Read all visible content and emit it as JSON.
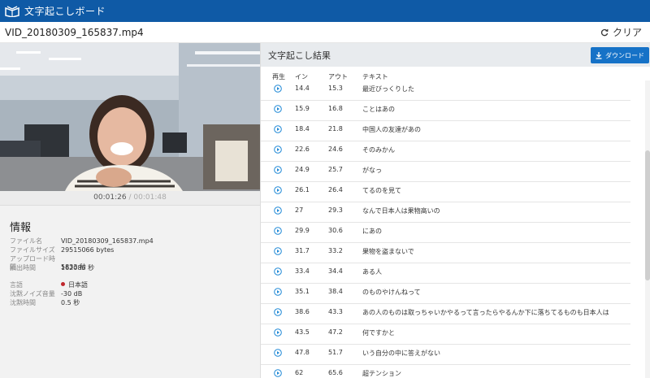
{
  "app": {
    "title": "文字起こしボード"
  },
  "file": {
    "name": "VID_20180309_165837.mp4",
    "clear_label": "クリア"
  },
  "player": {
    "current_time": "00:01:26",
    "separator": "/",
    "total_time": "00:01:48"
  },
  "info": {
    "heading": "情報",
    "fields": [
      {
        "label": "ファイル名",
        "value": "VID_20180309_165837.mp4"
      },
      {
        "label": "ファイルサイズ",
        "value": "29515066 bytes"
      },
      {
        "label": "アップロード時間",
        "value": "5833 秒"
      },
      {
        "label": "抽出時間",
        "value": "162086 秒"
      }
    ],
    "settings": [
      {
        "label": "言語",
        "value": "日本語"
      },
      {
        "label": "沈黙ノイズ音量",
        "value": "-30 dB"
      },
      {
        "label": "沈黙時間",
        "value": "0.5 秒"
      }
    ]
  },
  "results": {
    "title": "文字起こし結果",
    "download_label": "ダウンロード",
    "columns": {
      "play": "再生",
      "in": "イン",
      "out": "アウト",
      "text": "テキスト"
    },
    "rows": [
      {
        "in": "14.4",
        "out": "15.3",
        "text": "最近びっくりした"
      },
      {
        "in": "15.9",
        "out": "16.8",
        "text": "ことはあの"
      },
      {
        "in": "18.4",
        "out": "21.8",
        "text": "中国人の友達があの"
      },
      {
        "in": "22.6",
        "out": "24.6",
        "text": "そのみかん"
      },
      {
        "in": "24.9",
        "out": "25.7",
        "text": "がなっ"
      },
      {
        "in": "26.1",
        "out": "26.4",
        "text": "てるのを見て"
      },
      {
        "in": "27",
        "out": "29.3",
        "text": "なんで日本人は果物高いの"
      },
      {
        "in": "29.9",
        "out": "30.6",
        "text": "にあの"
      },
      {
        "in": "31.7",
        "out": "33.2",
        "text": "果物を盗まないで"
      },
      {
        "in": "33.4",
        "out": "34.4",
        "text": "ある人"
      },
      {
        "in": "35.1",
        "out": "38.4",
        "text": "のものやけんねって"
      },
      {
        "in": "38.6",
        "out": "43.3",
        "text": "あの人のものは取っちゃいかやるって言ったらやるんか下に落ちてるものも日本人は"
      },
      {
        "in": "43.5",
        "out": "47.2",
        "text": "何ですかと"
      },
      {
        "in": "47.8",
        "out": "51.7",
        "text": "いう自分の中に答えがない"
      },
      {
        "in": "62",
        "out": "65.6",
        "text": "超テンション"
      }
    ]
  },
  "colors": {
    "appbar": "#0f5aa6",
    "download_button": "#1672c7",
    "play_icon": "#1e88d6",
    "lang_dot": "#c0272d"
  }
}
